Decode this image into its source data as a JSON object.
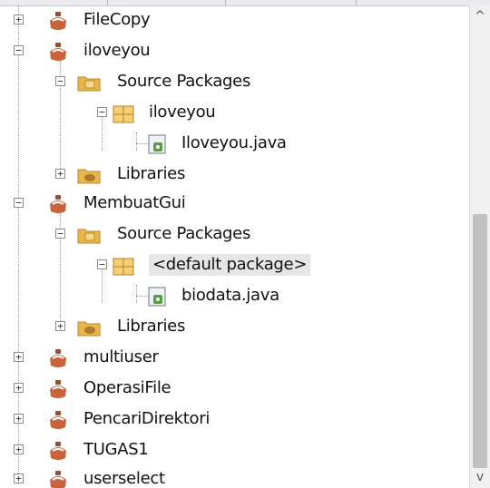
{
  "tree": {
    "nodes": [
      {
        "label": "FileCopy",
        "icon": "project-icon"
      },
      {
        "label": "iloveyou",
        "icon": "project-icon"
      },
      {
        "label": "Source Packages",
        "icon": "source-packages-icon"
      },
      {
        "label": "iloveyou",
        "icon": "package-icon"
      },
      {
        "label": "Iloveyou.java",
        "icon": "java-file-icon"
      },
      {
        "label": "Libraries",
        "icon": "libraries-icon"
      },
      {
        "label": "MembuatGui",
        "icon": "project-icon"
      },
      {
        "label": "Source Packages",
        "icon": "source-packages-icon"
      },
      {
        "label": "<default package>",
        "icon": "package-icon"
      },
      {
        "label": "biodata.java",
        "icon": "java-file-icon"
      },
      {
        "label": "Libraries",
        "icon": "libraries-icon"
      },
      {
        "label": "multiuser",
        "icon": "project-icon"
      },
      {
        "label": "OperasiFile",
        "icon": "project-icon"
      },
      {
        "label": "PencariDirektori",
        "icon": "project-icon"
      },
      {
        "label": "TUGAS1",
        "icon": "project-icon"
      },
      {
        "label": "userselect",
        "icon": "project-icon"
      }
    ]
  },
  "scrollbar": {
    "up_arrow": "^",
    "down_arrow": "v"
  },
  "colors": {
    "selection": "#e6e6e6",
    "folder": "#e8b64a",
    "project": "#c8633a",
    "package": "#e2a73f",
    "java": "#5a9b45"
  }
}
